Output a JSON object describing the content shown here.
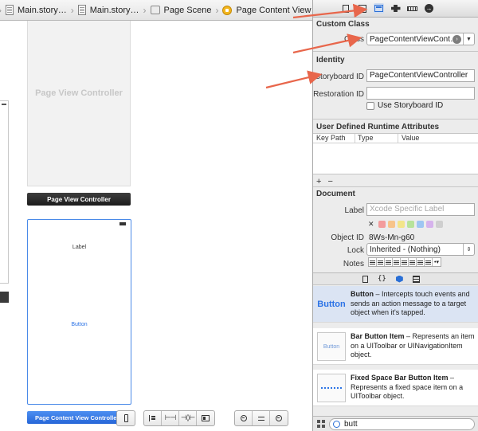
{
  "breadcrumbs": [
    {
      "label": "Main.story…"
    },
    {
      "label": "Main.story…"
    },
    {
      "label": "Page Scene"
    },
    {
      "label": "Page Content View Controller"
    }
  ],
  "canvas": {
    "page_view_controller": {
      "title": "Page View Controller",
      "label": "Page View Controller"
    },
    "page_content_view_controller": {
      "label_text": "Label",
      "button_text": "Button",
      "label": "Page Content View Controller"
    }
  },
  "inspector": {
    "custom_class": {
      "title": "Custom Class",
      "class_label": "Class",
      "class_value": "PageContentViewCont…"
    },
    "identity": {
      "title": "Identity",
      "storyboard_id_label": "Storyboard ID",
      "storyboard_id_value": "PageContentViewController",
      "restoration_id_label": "Restoration ID",
      "restoration_id_value": "",
      "use_storyboard_id_label": "Use Storyboard ID"
    },
    "udra": {
      "title": "User Defined Runtime Attributes",
      "columns": [
        "Key Path",
        "Type",
        "Value"
      ],
      "add": "+",
      "remove": "−"
    },
    "document": {
      "title": "Document",
      "label_label": "Label",
      "label_placeholder": "Xcode Specific Label",
      "object_id_label": "Object ID",
      "object_id_value": "8Ws-Mn-g60",
      "lock_label": "Lock",
      "lock_value": "Inherited - (Nothing)",
      "notes_label": "Notes",
      "swatch_colors": [
        "#f39c9c",
        "#f7c48a",
        "#f3e58a",
        "#b7e39a",
        "#9ec6f2",
        "#d6b3ec",
        "#cfcfcf"
      ]
    }
  },
  "library": {
    "items": [
      {
        "icon_text": "Button",
        "name": "Button",
        "desc": " – Intercepts touch events and sends an action message to a target object when it's tapped."
      },
      {
        "icon_text": "Button",
        "name": "Bar Button Item",
        "desc": " – Represents an item on a UIToolbar or UINavigationItem object."
      },
      {
        "icon_text": "",
        "name": "Fixed Space Bar Button Item",
        "desc": " – Represents a fixed space item on a UIToolbar object."
      }
    ],
    "filter_value": "butt"
  },
  "colors": {
    "accent": "#2c73e6",
    "arrow": "#e8664b"
  }
}
